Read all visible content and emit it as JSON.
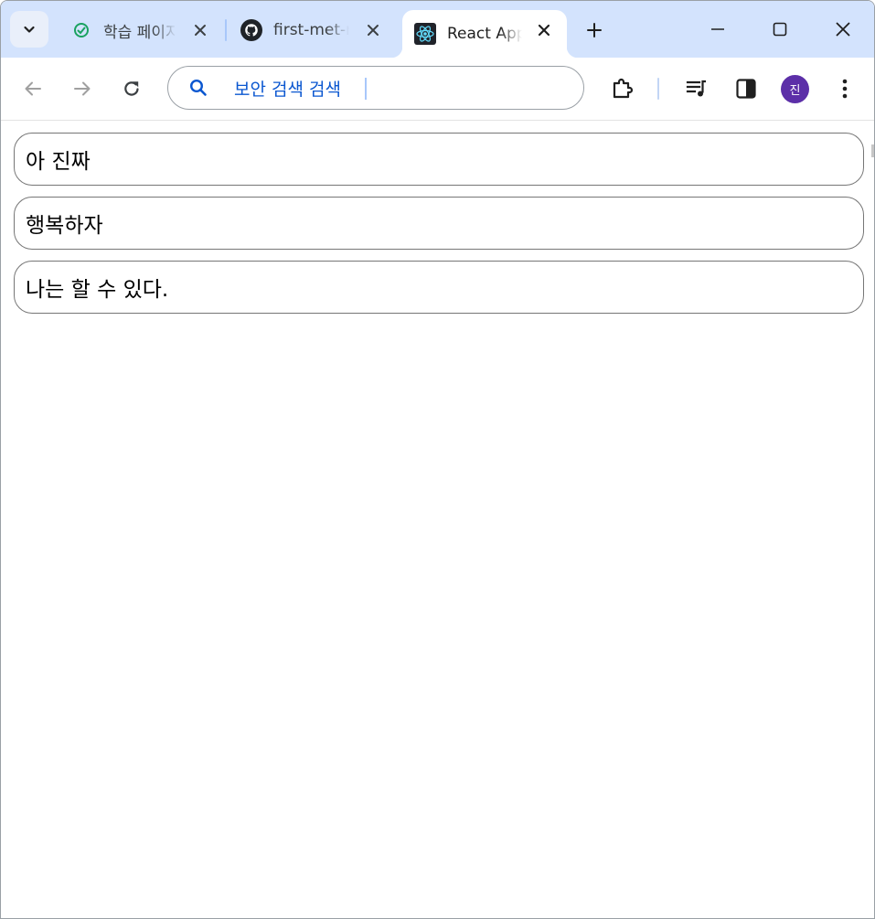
{
  "browser": {
    "tabs": [
      {
        "title": "학습 페이지",
        "favicon": "clock-check-icon"
      },
      {
        "title": "first-met-react",
        "favicon": "github-icon"
      },
      {
        "title": "React App",
        "favicon": "react-icon",
        "active": true
      }
    ],
    "omnibox": {
      "value": "보안 검색 검색"
    },
    "avatar_initial": "진",
    "accent_color": "#d3e3fd",
    "avatar_color": "#5c2fa8"
  },
  "page": {
    "todo_inputs": [
      {
        "value": "아 진짜"
      },
      {
        "value": "행복하자"
      },
      {
        "value": "나는 할 수 있다."
      }
    ]
  }
}
